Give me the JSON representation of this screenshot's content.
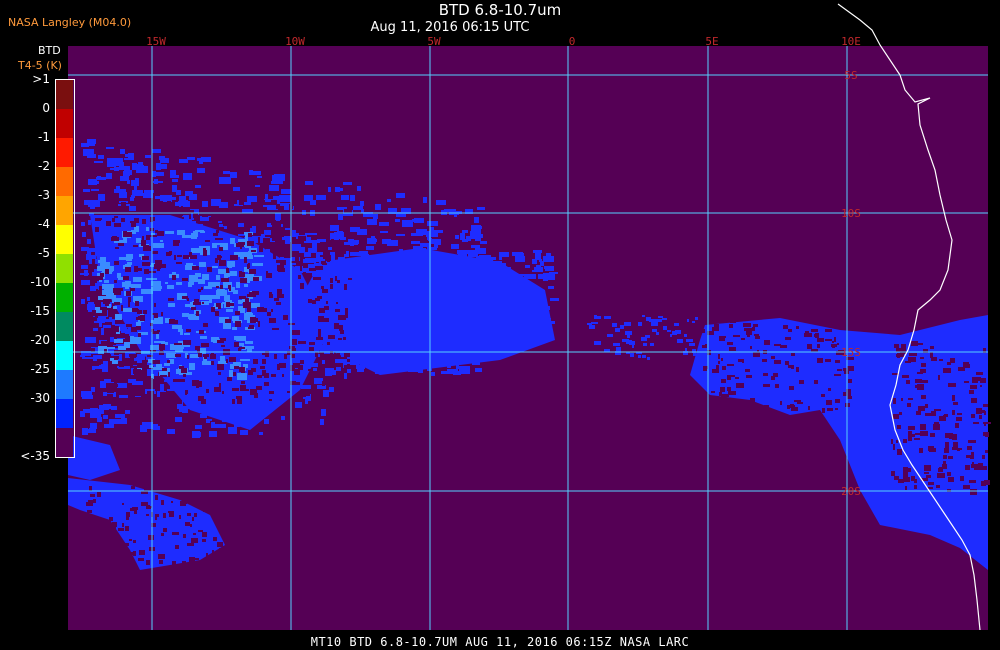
{
  "header": {
    "agency": "NASA Langley (M04.0)",
    "title": "BTD 6.8-10.7um",
    "subtitle": "Aug 11, 2016 06:15 UTC"
  },
  "colorbar": {
    "title_line1": "BTD",
    "title_line2": "T4-5 (K)",
    "entries": [
      {
        "label": ">1",
        "color": "#7a0f0f"
      },
      {
        "label": "0",
        "color": "#c00000"
      },
      {
        "label": "-1",
        "color": "#ff1a00"
      },
      {
        "label": "-2",
        "color": "#ff6a00"
      },
      {
        "label": "-3",
        "color": "#ffa500"
      },
      {
        "label": "-4",
        "color": "#ffff00"
      },
      {
        "label": "-5",
        "color": "#90e000"
      },
      {
        "label": "-10",
        "color": "#00b000"
      },
      {
        "label": "-15",
        "color": "#008a60"
      },
      {
        "label": "-20",
        "color": "#00ffff"
      },
      {
        "label": "-25",
        "color": "#1e7aff"
      },
      {
        "label": "-30",
        "color": "#0022ff"
      },
      {
        "label": "<-35",
        "color": "#550055"
      }
    ]
  },
  "map": {
    "background_color": "#550055",
    "cloud_color": "#1e2cff",
    "cloud_light_color": "#3a8cff",
    "grid_color": "#55d0ff",
    "coast_color": "#ffffff",
    "lon_labels": [
      "15W",
      "10W",
      "5W",
      "0",
      "5E",
      "10E"
    ],
    "lat_labels": [
      "5S",
      "10S",
      "15S",
      "20S"
    ]
  },
  "footer": {
    "text": "MT10   BTD 6.8-10.7UM   AUG 11, 2016 06:15Z   NASA LARC"
  }
}
